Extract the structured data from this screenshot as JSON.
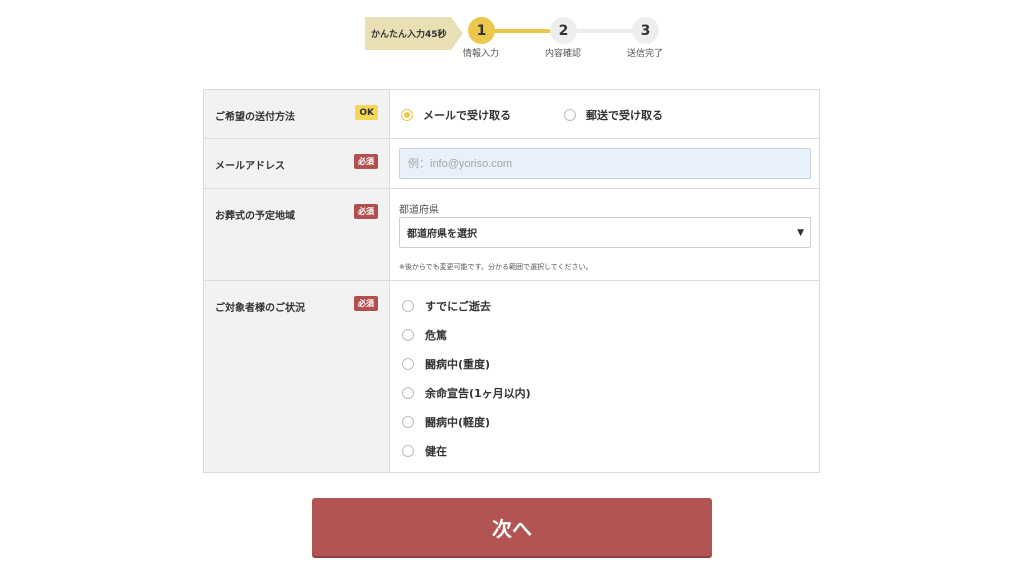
{
  "stepper": {
    "time_tag": "かんたん入力45秒",
    "steps": [
      {
        "number": "1",
        "label": "情報入力"
      },
      {
        "number": "2",
        "label": "内容確認"
      },
      {
        "number": "3",
        "label": "送信完了"
      }
    ]
  },
  "form": {
    "delivery": {
      "label": "ご希望の送付方法",
      "badge": "OK",
      "options": [
        "メールで受け取る",
        "郵送で受け取る"
      ],
      "selected": "メールで受け取る"
    },
    "email": {
      "label": "メールアドレス",
      "badge": "必須",
      "placeholder": "例：info@yoriso.com",
      "value": ""
    },
    "region": {
      "label": "お葬式の予定地域",
      "badge": "必須",
      "sub_label": "都道府県",
      "select_value": "都道府県を選択",
      "note": "※後からでも変更可能です。分かる範囲で選択してください。"
    },
    "status": {
      "label": "ご対象者様のご状況",
      "badge": "必須",
      "options": [
        "すでにご逝去",
        "危篤",
        "闘病中(重度)",
        "余命宣告(1ヶ月以内)",
        "闘病中(軽度)",
        "健在"
      ]
    }
  },
  "next_button": {
    "label": "次へ"
  },
  "colors": {
    "accent_yellow": "#e9c84b",
    "required_red": "#b05050",
    "button_red": "#b25454"
  }
}
